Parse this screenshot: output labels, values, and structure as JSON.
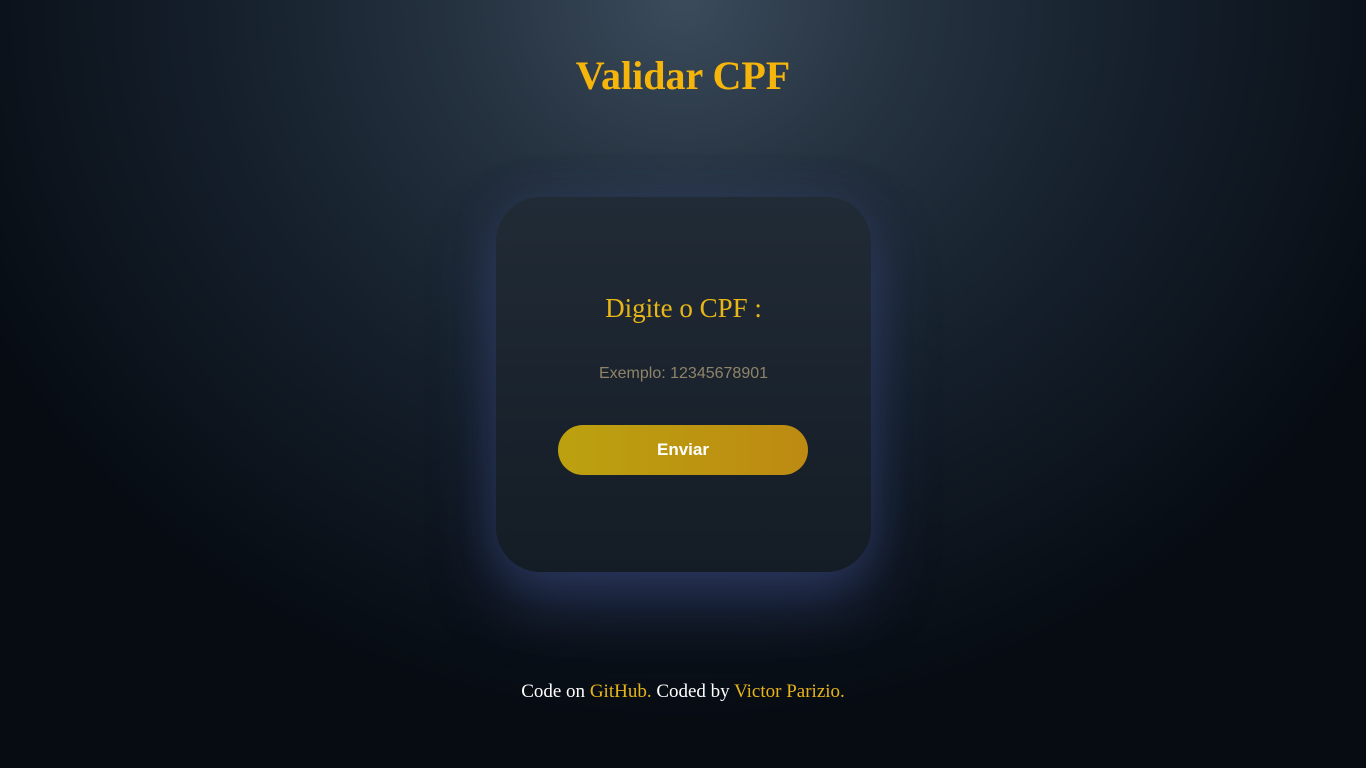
{
  "page": {
    "title": "Validar CPF"
  },
  "form": {
    "label": "Digite o CPF :",
    "input_placeholder": "Exemplo: 12345678901",
    "input_value": "",
    "submit_label": "Enviar"
  },
  "footer": {
    "prefix": "Code on ",
    "github_link": "GitHub.",
    "middle": " Coded by ",
    "author_link": "Victor Parizio."
  },
  "colors": {
    "accent": "#f5b50a",
    "button_gradient_start": "#bca10f",
    "button_gradient_end": "#bd8a12",
    "card_background": "#1d2630",
    "footer_text": "#ffffff"
  }
}
